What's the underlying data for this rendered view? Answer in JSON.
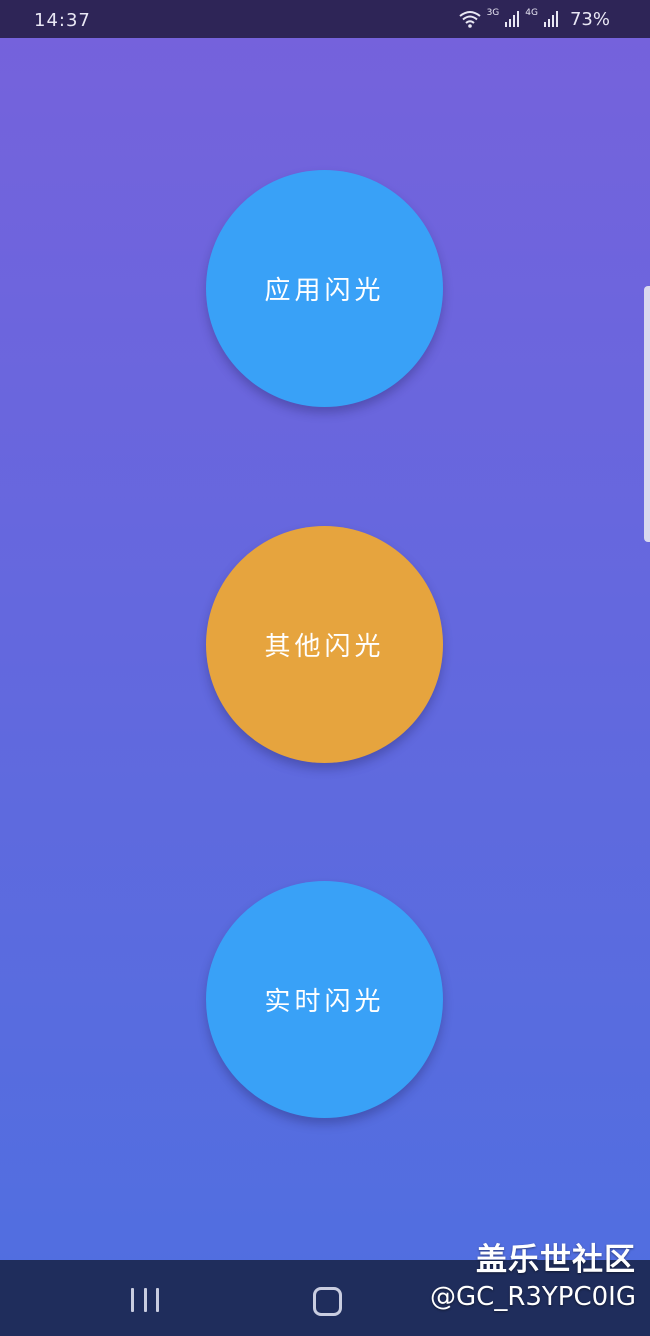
{
  "status_bar": {
    "time": "14:37",
    "network_3g": "3G",
    "network_4g": "4G",
    "battery": "73%"
  },
  "buttons": [
    {
      "label": "应用闪光",
      "color": "#39a1f7"
    },
    {
      "label": "其他闪光",
      "color": "#e6a43e"
    },
    {
      "label": "实时闪光",
      "color": "#39a1f7"
    }
  ],
  "colors": {
    "status_bar_bg": "#2e2557",
    "nav_bar_bg": "#1f2d5c",
    "gradient_top": "#7662dc",
    "gradient_bottom": "#4f6fe0"
  },
  "nav_bar": {
    "icons": [
      "recents-icon",
      "home-icon"
    ]
  },
  "watermark": {
    "title": "盖乐世社区",
    "user": "@GC_R3YPC0IG"
  }
}
